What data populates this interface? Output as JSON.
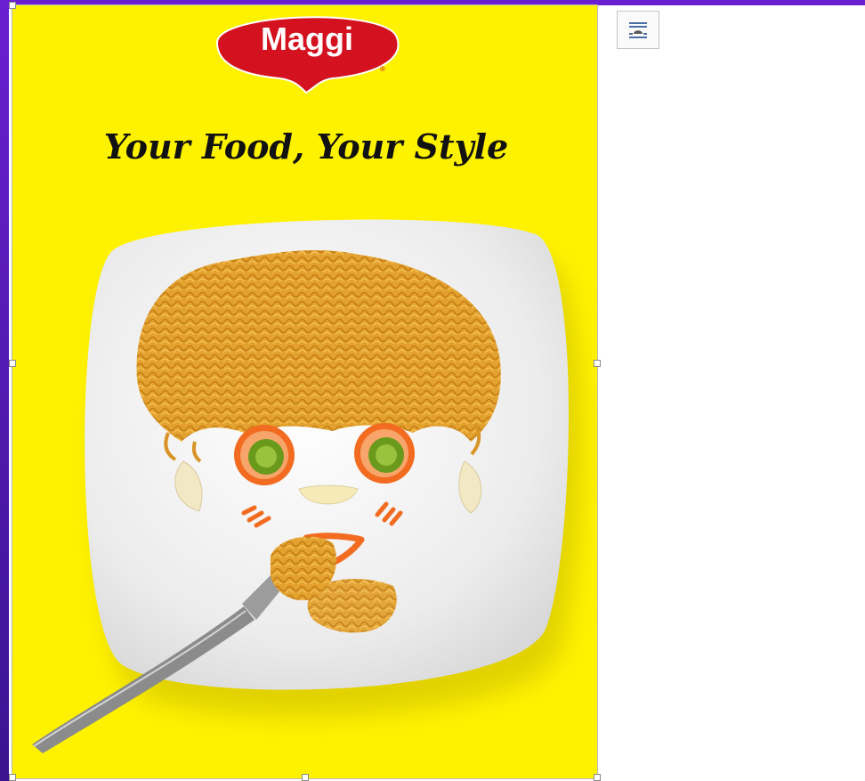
{
  "poster": {
    "brand": "Maggi",
    "registered_mark": "®",
    "tagline": "Your Food, Your Style",
    "colors": {
      "background": "#fff200",
      "logo_red": "#d4111e",
      "plate": "#f4f4f4",
      "noodles": "#e3a22f",
      "carrot": "#f26b21",
      "lime": "#6a9a1b",
      "window_accent": "#6a1fd0"
    }
  },
  "toolbar": {
    "layout_options_icon": "layout-options-icon"
  }
}
